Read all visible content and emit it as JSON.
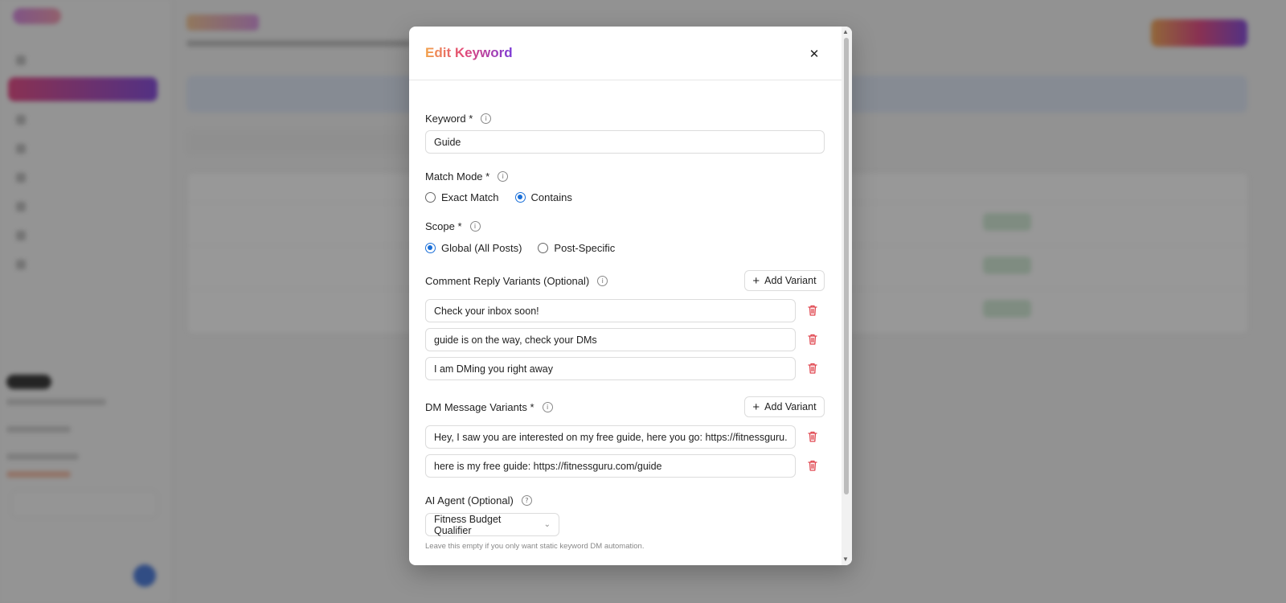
{
  "modal": {
    "title": "Edit Keyword",
    "close_label": "✕",
    "keyword": {
      "label": "Keyword *",
      "value": "Guide"
    },
    "match_mode": {
      "label": "Match Mode *",
      "options": [
        {
          "label": "Exact Match",
          "checked": false
        },
        {
          "label": "Contains",
          "checked": true
        }
      ]
    },
    "scope": {
      "label": "Scope *",
      "options": [
        {
          "label": "Global (All Posts)",
          "checked": true
        },
        {
          "label": "Post-Specific",
          "checked": false
        }
      ]
    },
    "comment_variants": {
      "label": "Comment Reply Variants (Optional)",
      "add_label": "Add Variant",
      "items": [
        "Check your inbox soon!",
        "guide is on the way, check your DMs",
        "I am DMing you right away"
      ]
    },
    "dm_variants": {
      "label": "DM Message Variants *",
      "add_label": "Add Variant",
      "items": [
        "Hey, I saw you are interested on my free guide, here you go: https://fitnessguru.com/",
        "here is my free guide: https://fitnessguru.com/guide"
      ]
    },
    "ai_agent": {
      "label": "AI Agent (Optional)",
      "selected": "Fitness Budget Qualifier",
      "hint": "Leave this empty if you only want static keyword DM automation."
    }
  },
  "colors": {
    "accent_blue": "#1a6fd8",
    "danger_red": "#e0464f",
    "title_gradient": [
      "#f2a24a",
      "#e2487a",
      "#7a3ad8"
    ]
  }
}
